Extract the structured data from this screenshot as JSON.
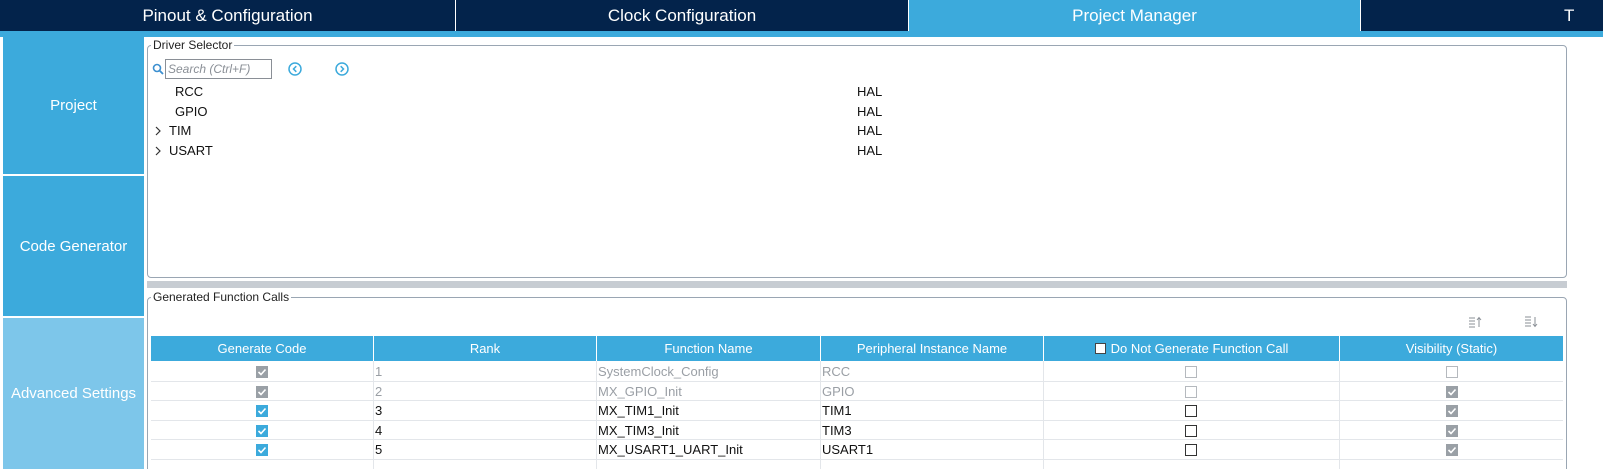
{
  "tabs": [
    {
      "label": "Pinout & Configuration"
    },
    {
      "label": "Clock Configuration"
    },
    {
      "label": "Project Manager"
    },
    {
      "label": "T"
    }
  ],
  "sidebar": {
    "items": [
      {
        "label": "Project"
      },
      {
        "label": "Code Generator"
      },
      {
        "label": "Advanced Settings"
      }
    ]
  },
  "driver_selector": {
    "title": "Driver Selector",
    "search_placeholder": "Search (Ctrl+F)",
    "rows": [
      {
        "name": "RCC",
        "value": "HAL",
        "expandable": false
      },
      {
        "name": "GPIO",
        "value": "HAL",
        "expandable": false
      },
      {
        "name": "TIM",
        "value": "HAL",
        "expandable": true
      },
      {
        "name": "USART",
        "value": "HAL",
        "expandable": true
      }
    ]
  },
  "function_calls": {
    "title": "Generated Function Calls",
    "headers": [
      "Generate Code",
      "Rank",
      "Function Name",
      "Peripheral Instance Name",
      "Do Not Generate Function Call",
      "Visibility (Static)"
    ],
    "rows": [
      {
        "generate": true,
        "enabled": false,
        "rank": "1",
        "function": "SystemClock_Config",
        "instance": "RCC",
        "do_not_generate": false,
        "visibility": false
      },
      {
        "generate": true,
        "enabled": false,
        "rank": "2",
        "function": "MX_GPIO_Init",
        "instance": "GPIO",
        "do_not_generate": false,
        "visibility": true
      },
      {
        "generate": true,
        "enabled": true,
        "rank": "3",
        "function": "MX_TIM1_Init",
        "instance": "TIM1",
        "do_not_generate": false,
        "visibility": true
      },
      {
        "generate": true,
        "enabled": true,
        "rank": "4",
        "function": "MX_TIM3_Init",
        "instance": "TIM3",
        "do_not_generate": false,
        "visibility": true
      },
      {
        "generate": true,
        "enabled": true,
        "rank": "5",
        "function": "MX_USART1_UART_Init",
        "instance": "USART1",
        "do_not_generate": false,
        "visibility": true
      }
    ]
  },
  "colors": {
    "tab_dark": "#03234b",
    "accent": "#3caadc",
    "sidebar_light": "#7dc6ea"
  }
}
